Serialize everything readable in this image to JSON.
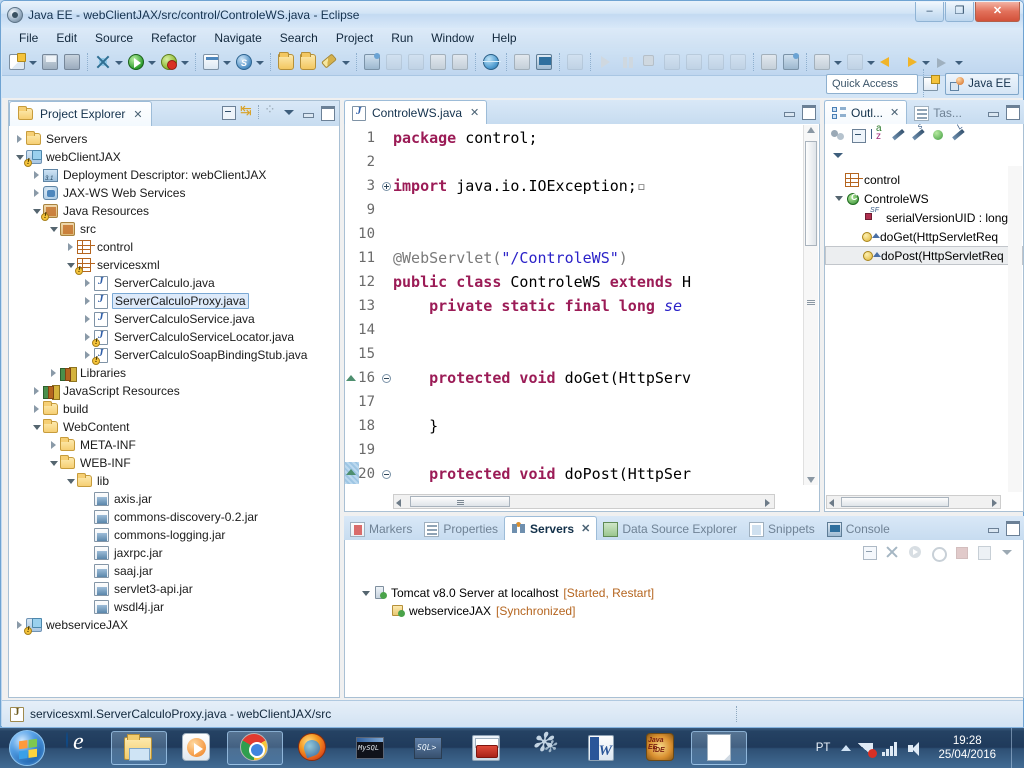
{
  "window": {
    "title": "Java EE - webClientJAX/src/control/ControleWS.java - Eclipse",
    "icon": "eclipse-icon",
    "minimize": "–",
    "restore": "❐",
    "close": "✕"
  },
  "menubar": {
    "items": [
      "File",
      "Edit",
      "Source",
      "Refactor",
      "Navigate",
      "Search",
      "Project",
      "Run",
      "Window",
      "Help"
    ]
  },
  "toolbar": {
    "quick_access_placeholder": "Quick Access",
    "perspective_label": "Java EE",
    "open_perspective_tooltip": "Open Perspective"
  },
  "project_explorer": {
    "tab_label": "Project Explorer",
    "tab_close": "✕",
    "tree": [
      {
        "label": "Servers",
        "depth": 0,
        "twist": "closed",
        "icon": "folder-icon"
      },
      {
        "label": "webClientJAX",
        "depth": 0,
        "twist": "open",
        "icon": "project-icon",
        "warn": true
      },
      {
        "label": "Deployment Descriptor: webClientJAX",
        "depth": 1,
        "twist": "closed",
        "icon": "deployment-descriptor-icon"
      },
      {
        "label": "JAX-WS Web Services",
        "depth": 1,
        "twist": "closed",
        "icon": "jaxws-icon"
      },
      {
        "label": "Java Resources",
        "depth": 1,
        "twist": "open",
        "icon": "java-resources-icon",
        "warn": true
      },
      {
        "label": "src",
        "depth": 2,
        "twist": "open",
        "icon": "source-folder-icon"
      },
      {
        "label": "control",
        "depth": 3,
        "twist": "closed",
        "icon": "package-icon"
      },
      {
        "label": "servicesxml",
        "depth": 3,
        "twist": "open",
        "icon": "package-icon",
        "warn": true
      },
      {
        "label": "ServerCalculo.java",
        "depth": 4,
        "twist": "closed",
        "icon": "java-file-icon"
      },
      {
        "label": "ServerCalculoProxy.java",
        "depth": 4,
        "twist": "closed",
        "icon": "java-file-icon",
        "selected": true
      },
      {
        "label": "ServerCalculoService.java",
        "depth": 4,
        "twist": "closed",
        "icon": "java-file-icon"
      },
      {
        "label": "ServerCalculoServiceLocator.java",
        "depth": 4,
        "twist": "closed",
        "icon": "java-file-icon",
        "warn": true
      },
      {
        "label": "ServerCalculoSoapBindingStub.java",
        "depth": 4,
        "twist": "closed",
        "icon": "java-file-icon",
        "warn": true
      },
      {
        "label": "Libraries",
        "depth": 2,
        "twist": "closed",
        "icon": "libraries-icon"
      },
      {
        "label": "JavaScript Resources",
        "depth": 1,
        "twist": "closed",
        "icon": "libraries-icon"
      },
      {
        "label": "build",
        "depth": 1,
        "twist": "closed",
        "icon": "folder-icon"
      },
      {
        "label": "WebContent",
        "depth": 1,
        "twist": "open",
        "icon": "folder-icon"
      },
      {
        "label": "META-INF",
        "depth": 2,
        "twist": "closed",
        "icon": "folder-icon"
      },
      {
        "label": "WEB-INF",
        "depth": 2,
        "twist": "open",
        "icon": "folder-icon"
      },
      {
        "label": "lib",
        "depth": 3,
        "twist": "open",
        "icon": "folder-icon"
      },
      {
        "label": "axis.jar",
        "depth": 4,
        "twist": "none",
        "icon": "jar-icon"
      },
      {
        "label": "commons-discovery-0.2.jar",
        "depth": 4,
        "twist": "none",
        "icon": "jar-icon"
      },
      {
        "label": "commons-logging.jar",
        "depth": 4,
        "twist": "none",
        "icon": "jar-icon"
      },
      {
        "label": "jaxrpc.jar",
        "depth": 4,
        "twist": "none",
        "icon": "jar-icon"
      },
      {
        "label": "saaj.jar",
        "depth": 4,
        "twist": "none",
        "icon": "jar-icon"
      },
      {
        "label": "servlet3-api.jar",
        "depth": 4,
        "twist": "none",
        "icon": "jar-icon"
      },
      {
        "label": "wsdl4j.jar",
        "depth": 4,
        "twist": "none",
        "icon": "jar-icon"
      },
      {
        "label": "webserviceJAX",
        "depth": 0,
        "twist": "closed",
        "icon": "project-icon",
        "warn": true
      }
    ]
  },
  "editor": {
    "tab_label": "ControleWS.java",
    "tab_close": "✕",
    "lines": [
      {
        "num": "1",
        "fold": "",
        "segments": [
          {
            "t": "package",
            "c": "kw"
          },
          {
            "t": " control;",
            "c": "code"
          }
        ]
      },
      {
        "num": "2",
        "fold": "",
        "segments": []
      },
      {
        "num": "3",
        "fold": "plus",
        "segments": [
          {
            "t": "import",
            "c": "kw"
          },
          {
            "t": " java.io.IOException;",
            "c": "code"
          },
          {
            "t": "▫",
            "c": "ann"
          }
        ]
      },
      {
        "num": "9",
        "fold": "",
        "segments": []
      },
      {
        "num": "10",
        "fold": "",
        "segments": []
      },
      {
        "num": "11",
        "fold": "",
        "segments": [
          {
            "t": "@WebServlet(",
            "c": "ann"
          },
          {
            "t": "\"/ControleWS\"",
            "c": "str"
          },
          {
            "t": ")",
            "c": "ann"
          }
        ]
      },
      {
        "num": "12",
        "fold": "",
        "segments": [
          {
            "t": "public class",
            "c": "kw"
          },
          {
            "t": " ControleWS ",
            "c": "code"
          },
          {
            "t": "extends",
            "c": "kw"
          },
          {
            "t": " H",
            "c": "code"
          }
        ]
      },
      {
        "num": "13",
        "fold": "",
        "segments": [
          {
            "t": "    ",
            "c": "code"
          },
          {
            "t": "private static final long",
            "c": "kw"
          },
          {
            "t": " ",
            "c": "code"
          },
          {
            "t": "se",
            "c": "fld"
          }
        ]
      },
      {
        "num": "14",
        "fold": "",
        "segments": []
      },
      {
        "num": "15",
        "fold": "",
        "segments": []
      },
      {
        "num": "16",
        "fold": "minus",
        "marker": "overview",
        "segments": [
          {
            "t": "    ",
            "c": "code"
          },
          {
            "t": "protected void",
            "c": "kw"
          },
          {
            "t": " doGet(HttpServ",
            "c": "code"
          }
        ]
      },
      {
        "num": "17",
        "fold": "",
        "segments": []
      },
      {
        "num": "18",
        "fold": "",
        "segments": [
          {
            "t": "    }",
            "c": "code"
          }
        ]
      },
      {
        "num": "19",
        "fold": "",
        "segments": []
      },
      {
        "num": "20",
        "fold": "minus",
        "marker": "overview-block",
        "segments": [
          {
            "t": "    ",
            "c": "code"
          },
          {
            "t": "protected void",
            "c": "kw"
          },
          {
            "t": " doPost(HttpSer",
            "c": "code"
          }
        ]
      }
    ]
  },
  "outline": {
    "tab_label": "Outl...",
    "tab_close": "✕",
    "tab2_label": "Tas...",
    "tree": [
      {
        "label": "control",
        "icon": "package-icon",
        "depth": 0,
        "twist": "none"
      },
      {
        "label": "ControleWS",
        "icon": "class-icon",
        "depth": 0,
        "twist": "open"
      },
      {
        "label": "serialVersionUID : long",
        "icon": "static-final-field-icon",
        "depth": 1,
        "twist": "none"
      },
      {
        "label": "doGet(HttpServletReq",
        "icon": "method-icon",
        "depth": 1,
        "twist": "none"
      },
      {
        "label": "doPost(HttpServletReq",
        "icon": "method-icon",
        "depth": 1,
        "twist": "none",
        "selected": true
      }
    ]
  },
  "bottom_panel": {
    "tabs": [
      {
        "label": "Markers",
        "icon": "markers-icon",
        "active": false
      },
      {
        "label": "Properties",
        "icon": "properties-icon",
        "active": false
      },
      {
        "label": "Servers",
        "icon": "servers-icon",
        "active": true,
        "close": "✕"
      },
      {
        "label": "Data Source Explorer",
        "icon": "data-source-explorer-icon",
        "active": false
      },
      {
        "label": "Snippets",
        "icon": "snippets-icon",
        "active": false
      },
      {
        "label": "Console",
        "icon": "console-icon",
        "active": false
      }
    ],
    "servers": [
      {
        "name": "Tomcat v8.0 Server at localhost",
        "status": "[Started, Restart]",
        "icon": "server-icon",
        "depth": 0,
        "twist": "open"
      },
      {
        "name": "webserviceJAX",
        "status": "[Synchronized]",
        "icon": "module-icon",
        "depth": 1,
        "twist": "none"
      }
    ]
  },
  "statusbar": {
    "icon": "java-file-icon",
    "text": "servicesxml.ServerCalculoProxy.java - webClientJAX/src"
  },
  "taskbar": {
    "start_tooltip": "Start",
    "items": [
      {
        "name": "internet-explorer",
        "running": false
      },
      {
        "name": "windows-explorer",
        "running": true
      },
      {
        "name": "windows-media-player",
        "running": false
      },
      {
        "name": "google-chrome",
        "running": true
      },
      {
        "name": "mozilla-firefox",
        "running": false
      },
      {
        "name": "mysql-console",
        "running": false
      },
      {
        "name": "sql-console",
        "running": false
      },
      {
        "name": "toolbox-app",
        "running": false
      },
      {
        "name": "settings-app",
        "running": false
      },
      {
        "name": "microsoft-word",
        "running": false
      },
      {
        "name": "eclipse-java-ee-ide",
        "running": false
      },
      {
        "name": "document-window",
        "running": true
      }
    ],
    "tray": {
      "language": "PT",
      "time": "19:28",
      "date": "25/04/2016"
    }
  },
  "colors": {
    "accent": "#2f6f9e",
    "keyword": "#9b1b56",
    "string": "#2b22c8",
    "status": "#b5651f",
    "selection": "#ddeafa"
  }
}
